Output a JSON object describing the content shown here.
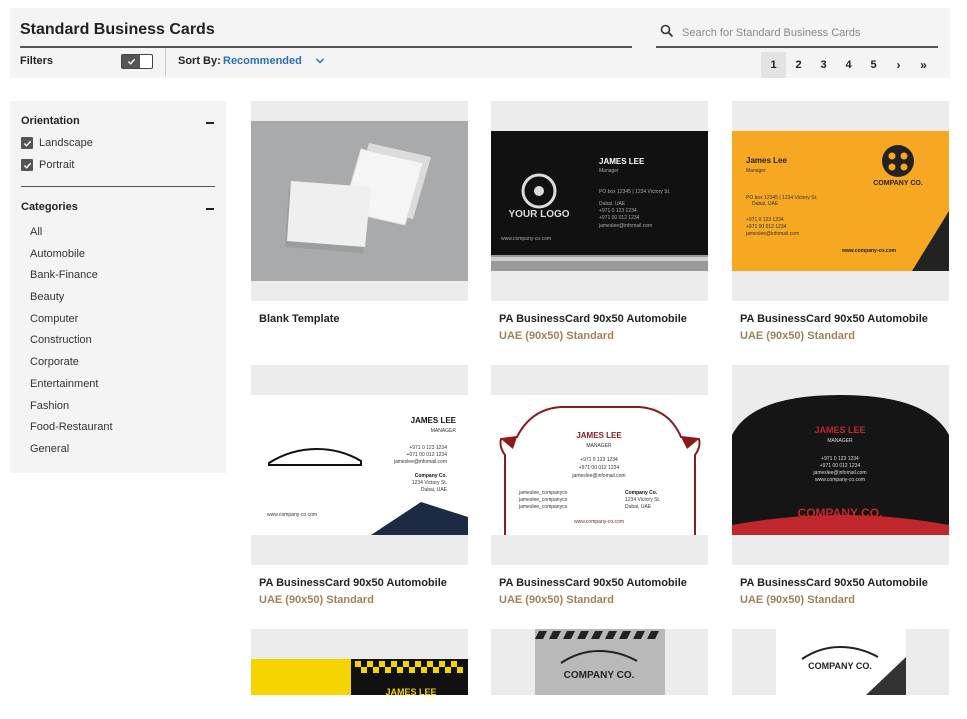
{
  "header": {
    "title": "Standard Business Cards",
    "search_placeholder": "Search for Standard Business Cards",
    "filters_label": "Filters",
    "sort_label": "Sort By:",
    "sort_value": "Recommended"
  },
  "pagination": {
    "pages": [
      "1",
      "2",
      "3",
      "4",
      "5"
    ],
    "active": "1",
    "next": "›",
    "last": "»"
  },
  "sidebar": {
    "orientation_title": "Orientation",
    "orientations": [
      "Landscape",
      "Portrait"
    ],
    "categories_title": "Categories",
    "categories": [
      "All",
      "Automobile",
      "Bank-Finance",
      "Beauty",
      "Computer",
      "Construction",
      "Corporate",
      "Entertainment",
      "Fashion",
      "Food-Restaurant",
      "General"
    ]
  },
  "cards": [
    {
      "name": "Blank Template",
      "sub": ""
    },
    {
      "name": "PA BusinessCard 90x50 Automobile",
      "sub": "UAE (90x50) Standard"
    },
    {
      "name": "PA BusinessCard 90x50 Automobile",
      "sub": "UAE (90x50) Standard"
    },
    {
      "name": "PA BusinessCard 90x50 Automobile",
      "sub": "UAE (90x50) Standard"
    },
    {
      "name": "PA BusinessCard 90x50 Automobile",
      "sub": "UAE (90x50) Standard"
    },
    {
      "name": "PA BusinessCard 90x50 Automobile",
      "sub": "UAE (90x50) Standard"
    }
  ],
  "previews": {
    "c2": {
      "name": "JAMES LEE",
      "role": "Manager",
      "addr1": "PO box 12345 | 1234 Victory St.",
      "addr2": "Dubai, UAE",
      "phone1": "+971 0 123 1234",
      "phone2": "+971 00 012 1234",
      "email": "jameslee@infomail.com",
      "web": "www.company-co.com",
      "logo": "YOUR LOGO"
    },
    "c3": {
      "name": "James Lee",
      "role": "Manager",
      "addr1": "PO box 12345 | 1234 Victory St.",
      "addr2": "Dubai, UAE",
      "phone1": "+971 0 123 1234",
      "phone2": "+971 00 012 1234",
      "email": "jameslee@infomail.com",
      "web": "www.company-co.com",
      "company": "COMPANY CO."
    },
    "c4": {
      "name": "JAMES LEE",
      "role": "MANAGER",
      "phone1": "+971 0 123 1234",
      "phone2": "+071 00 012 1234",
      "email": "jameslee@infomail.com",
      "company": "Company Co.",
      "addr1": "1234 Victory St.",
      "addr2": "Dubai, UAE",
      "web": "www.company-co.com"
    },
    "c5": {
      "name": "JAMES LEE",
      "role": "MANAGER",
      "phone1": "+971 0 123 1234",
      "phone2": "+971 00 012 1234",
      "email": "jameslee@infomail.com",
      "social1": "jameslee_companyco",
      "social2": "jameslee_companyco",
      "social3": "jameslee_companyco",
      "company": "Company Co.",
      "addr1": "1234 Victory St.",
      "addr2": "Dubai, UAE",
      "web": "www.company-co.com"
    },
    "c6": {
      "name": "JAMES LEE",
      "role": "MANAGER",
      "phone1": "+971 0 123 1234",
      "phone2": "+971 00 012 1234",
      "email": "jameslee@infomail.com",
      "web": "www.company-co.com",
      "company": "COMPANY CO."
    },
    "c7": {
      "name": "JAMES LEE"
    },
    "c8": {
      "company": "COMPANY CO."
    },
    "c9": {
      "company": "COMPANY CO."
    }
  },
  "colors": {
    "accent": "#2b6fb6",
    "sub": "#a0805a",
    "panel": "#f4f4f4",
    "orange": "#f7a823",
    "maroon": "#8b1a1a",
    "red": "#c0272d",
    "navy": "#1c2a44",
    "yellow": "#f5d400"
  }
}
